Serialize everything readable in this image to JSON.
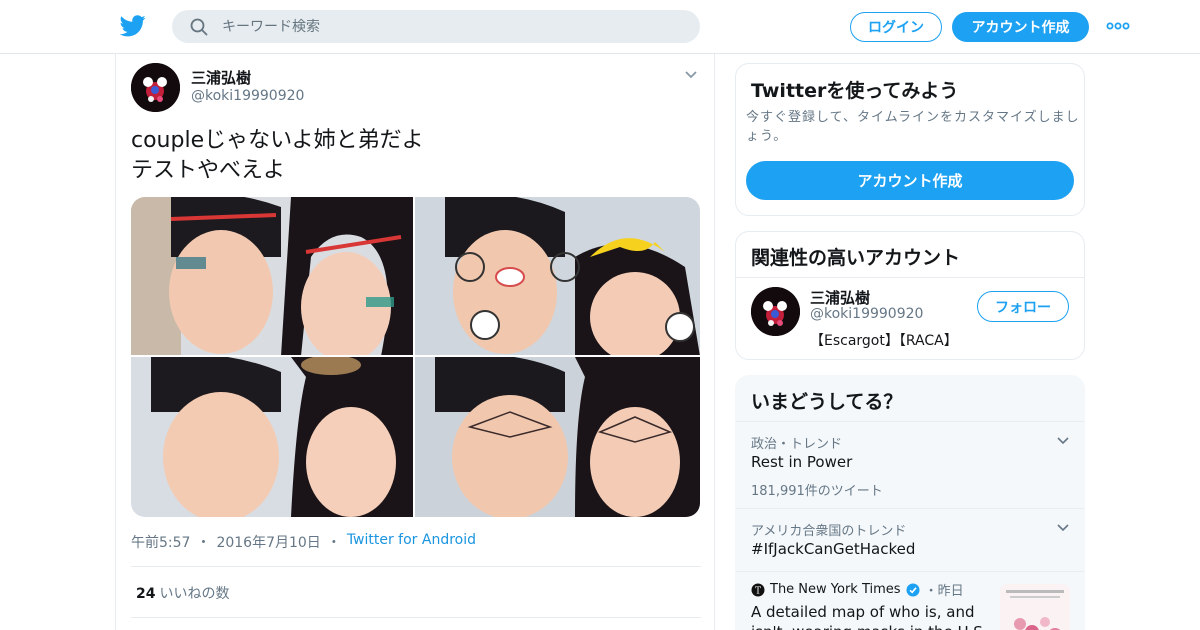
{
  "header": {
    "search_placeholder": "キーワード検索",
    "login_label": "ログイン",
    "signup_label": "アカウント作成"
  },
  "tweet": {
    "author_name": "三浦弘樹",
    "author_handle": "@koki19990920",
    "text": "coupleじゃないよ姉と弟だよ\nテストやべえよ",
    "time": "午前5:57",
    "date": "2016年7月10日",
    "source": "Twitter for Android",
    "separator": "・",
    "like_count": "24",
    "like_label": "いいねの数"
  },
  "sidebar": {
    "try": {
      "title": "Twitterを使ってみよう",
      "description": "今すぐ登録して、タイムラインをカスタマイズしましょう。",
      "button": "アカウント作成"
    },
    "related": {
      "title": "関連性の高いアカウント",
      "name": "三浦弘樹",
      "handle": "@koki19990920",
      "bio": "【Escargot】【RACA】",
      "follow_label": "フォロー"
    },
    "trends": {
      "title": "いまどうしてる？",
      "items": [
        {
          "context": "政治・トレンド",
          "name": "Rest in Power",
          "count": "181,991件のツイート"
        },
        {
          "context": "アメリカ合衆国のトレンド",
          "name": "#IfJackCanGetHacked",
          "count": ""
        }
      ],
      "news": {
        "source": "The New York Times",
        "time": "・昨日",
        "headline": "A detailed map of who is, and isn't, wearing masks in the U.S."
      }
    }
  },
  "colors": {
    "brand": "#1da1f2",
    "text": "#14171a",
    "muted": "#657786",
    "border": "#e6ecf0"
  },
  "icons": [
    "twitter-logo-icon",
    "search-icon",
    "more-icon",
    "chevron-down-icon",
    "verified-icon",
    "nyt-logo-icon"
  ]
}
